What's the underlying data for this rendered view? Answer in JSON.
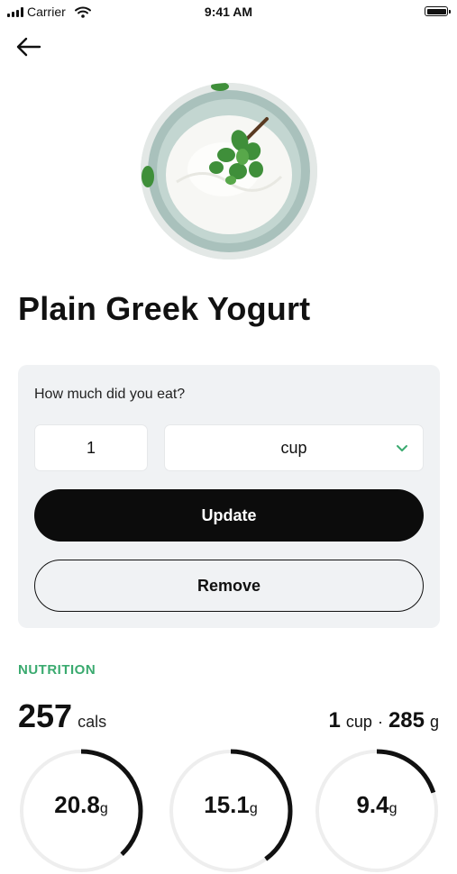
{
  "status_bar": {
    "carrier": "Carrier",
    "time": "9:41 AM"
  },
  "food": {
    "name": "Plain Greek Yogurt"
  },
  "portion": {
    "question": "How much did you eat?",
    "quantity": "1",
    "unit": "cup",
    "update_label": "Update",
    "remove_label": "Remove"
  },
  "nutrition": {
    "header": "NUTRITION",
    "calories": "257",
    "calories_unit": "cals",
    "serving_qty": "1",
    "serving_unit": "cup",
    "separator": "·",
    "serving_weight": "285",
    "serving_weight_unit": "g",
    "macros": [
      {
        "value": "20.8",
        "unit": "g",
        "fraction": 0.38
      },
      {
        "value": "15.1",
        "unit": "g",
        "fraction": 0.4
      },
      {
        "value": "9.4",
        "unit": "g",
        "fraction": 0.2
      }
    ]
  },
  "colors": {
    "accent_green": "#3aaa6f",
    "primary_button": "#0c0c0c",
    "card_bg": "#f0f2f4"
  },
  "icons": [
    "back-arrow-icon",
    "signal-icon",
    "wifi-icon",
    "battery-icon",
    "chevron-down-icon"
  ]
}
